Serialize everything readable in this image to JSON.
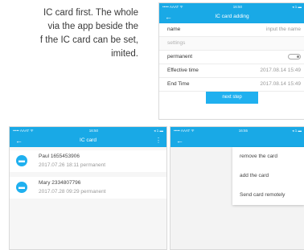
{
  "intro": {
    "lines": [
      "IC card first. The whole",
      "via the app beside the",
      "f the IC card can be set,",
      "imited."
    ]
  },
  "status": {
    "carrier": "•••••  AAAT  ᯤ",
    "time": "16:50",
    "battery": "◂ 1 ▬",
    "time_menu": "16:55"
  },
  "add_card": {
    "title": "IC card adding",
    "rows": {
      "name_label": "name",
      "name_placeholder": "input the name",
      "settings_label": "settings",
      "permanent_label": "permanent",
      "effective_label": "Effective time",
      "effective_value": "2017.08.14 15:49",
      "end_label": "End Time",
      "end_value": "2017.08.14 15:49"
    },
    "next_button": "next step"
  },
  "card_list": {
    "title": "IC card",
    "items": [
      {
        "name": "Paul   1655453906",
        "meta": "2017.07.26  18:11  permanent"
      },
      {
        "name": "Mary   2334807796",
        "meta": "2017.07.28  09:29  permanent"
      }
    ]
  },
  "card_menu": {
    "items": [
      "remove the card",
      "add the card",
      "Send card remotely"
    ]
  },
  "icons": {
    "back": "←",
    "more": "⋮",
    "card": "▬"
  },
  "colors": {
    "accent": "#19a9e6",
    "button": "#1fb0ef"
  }
}
